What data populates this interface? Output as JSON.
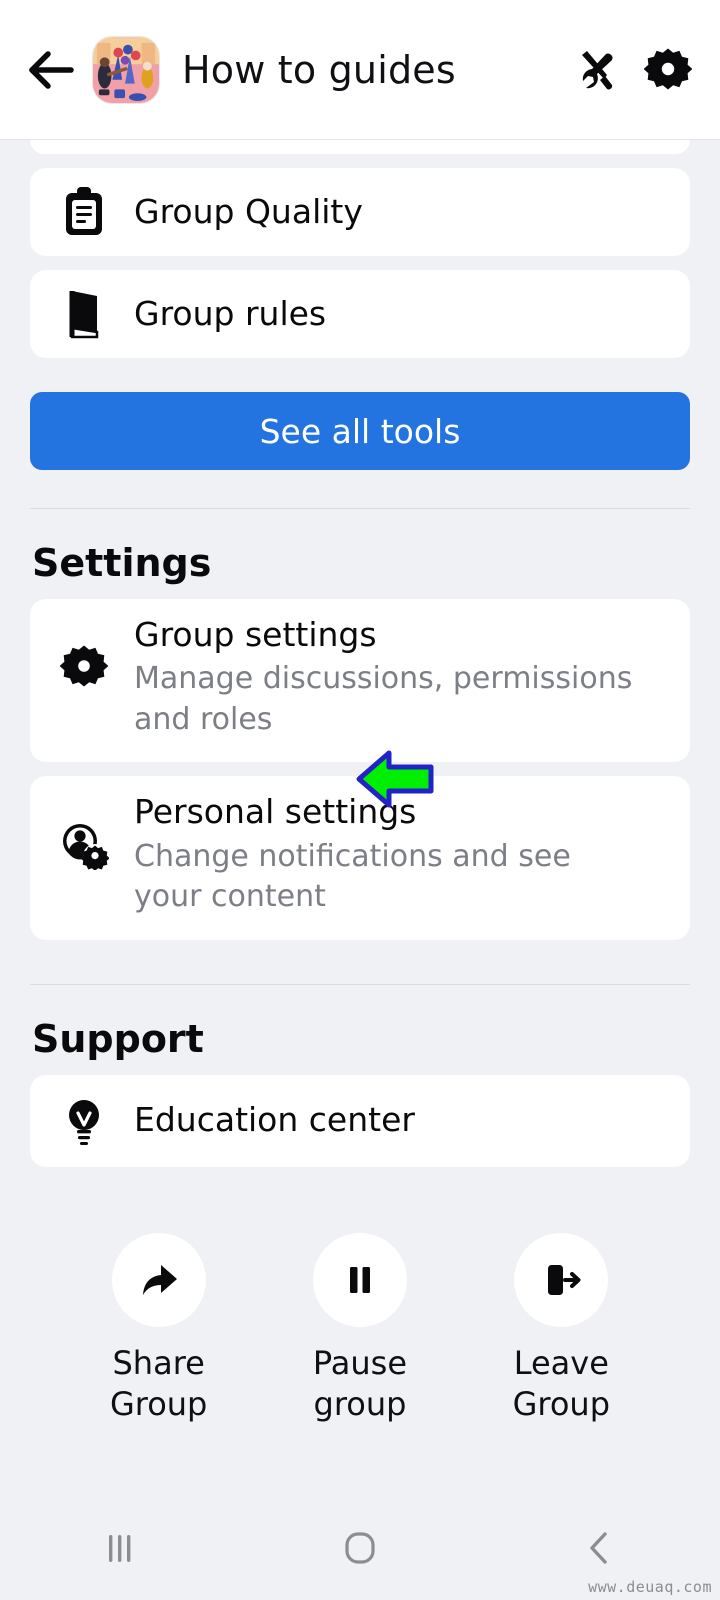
{
  "header": {
    "back_icon": "arrow-left-icon",
    "avatar_alt": "group-avatar-illustration",
    "title": "How to guides",
    "tools_icon": "wrench-screwdriver-icon",
    "settings_icon": "gear-icon"
  },
  "tools_section": {
    "items": [
      {
        "icon": "clipboard-icon",
        "label": "Group Quality"
      },
      {
        "icon": "book-icon",
        "label": "Group rules"
      }
    ],
    "see_all_label": "See all tools"
  },
  "settings_section": {
    "title": "Settings",
    "items": [
      {
        "icon": "gear-icon",
        "label": "Group settings",
        "sub": "Manage discussions, permissions and roles"
      },
      {
        "icon": "person-gear-icon",
        "label": "Personal settings",
        "sub": "Change notifications and see your content"
      }
    ]
  },
  "support_section": {
    "title": "Support",
    "items": [
      {
        "icon": "lightbulb-icon",
        "label": "Education center"
      }
    ]
  },
  "actions": [
    {
      "icon": "share-arrow-icon",
      "label": "Share Group"
    },
    {
      "icon": "pause-icon",
      "label": "Pause group"
    },
    {
      "icon": "exit-door-icon",
      "label": "Leave Group"
    }
  ],
  "annotation": {
    "type": "left-arrow",
    "target": "Group settings",
    "fill_color": "#00ef00",
    "stroke_color": "#2222c8"
  },
  "navbar": {
    "recents_icon": "recents-bars-icon",
    "home_icon": "home-square-icon",
    "back_icon": "back-chevron-icon"
  },
  "watermark": "www.deuaq.com",
  "colors": {
    "background": "#eff1f5",
    "card": "#ffffff",
    "primary": "#2374e1",
    "text": "#0a0a0c",
    "muted": "#7c7f86"
  }
}
